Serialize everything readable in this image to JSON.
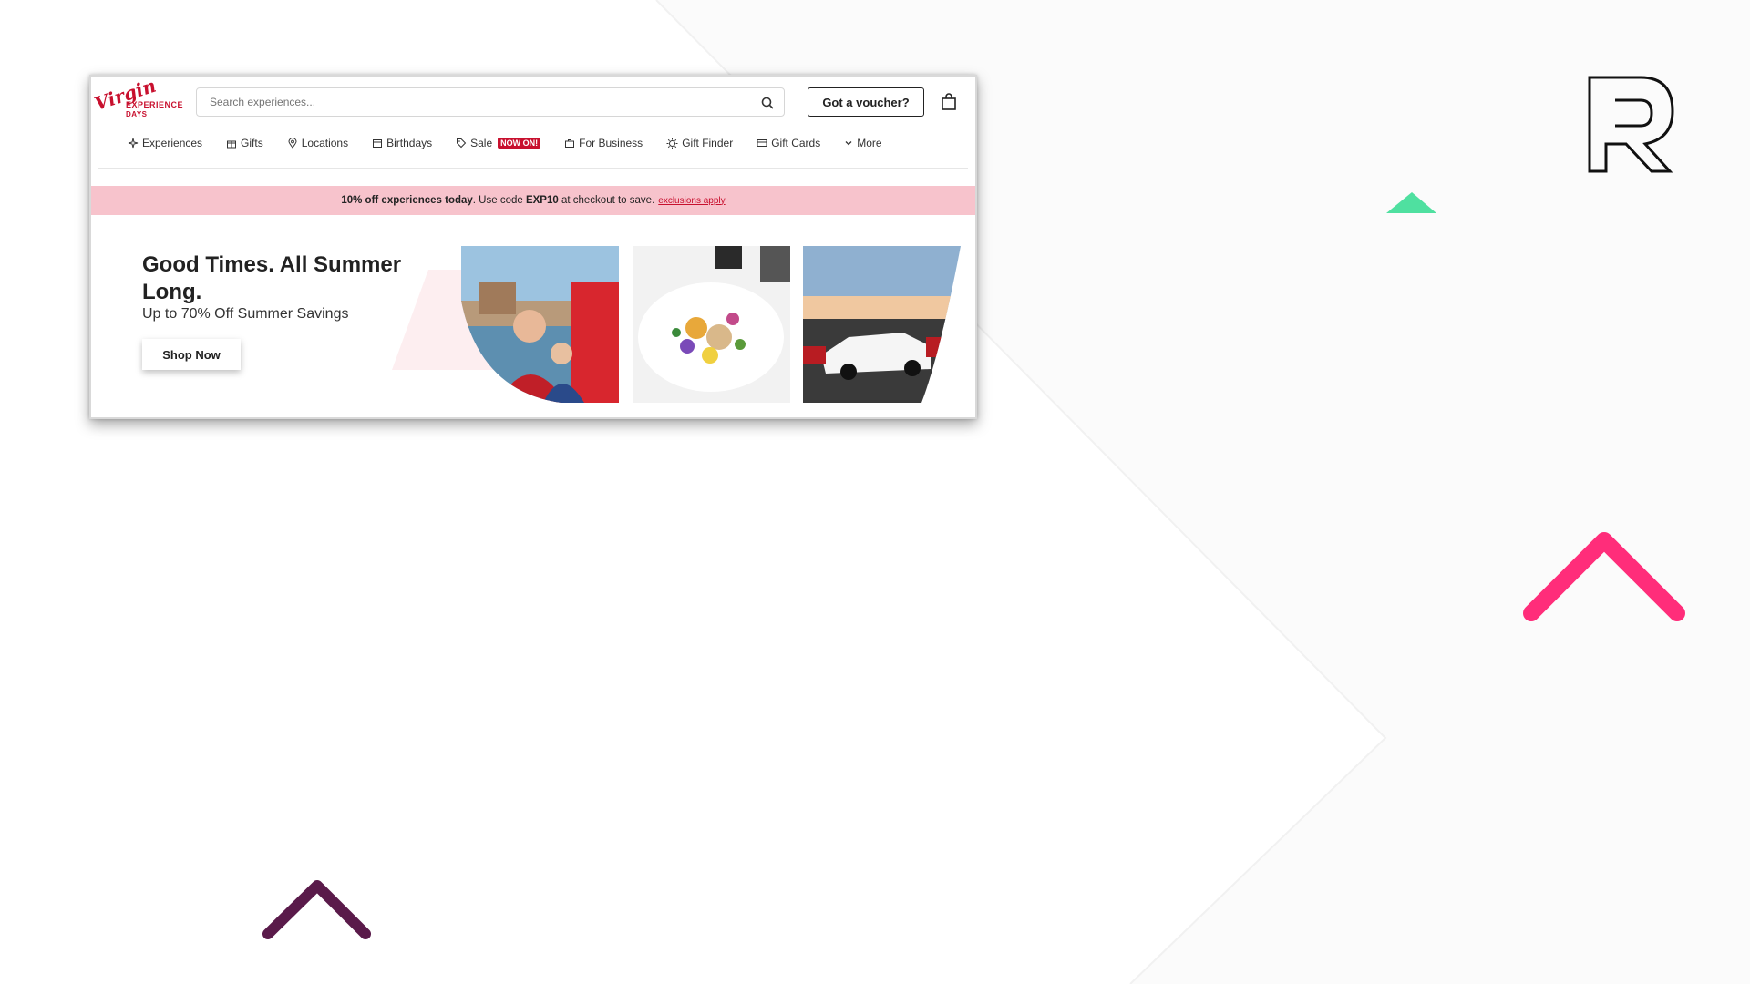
{
  "colors": {
    "brand_red": "#c8102e",
    "promo_bg": "#f7c3cc",
    "accent_pink": "#ff2d7a",
    "accent_green": "#4fe0a0",
    "accent_plum": "#5a1a4a"
  },
  "logo": {
    "script": "Virgin",
    "line1": "EXPERIENCE",
    "line2": "DAYS"
  },
  "search": {
    "placeholder": "Search experiences..."
  },
  "header": {
    "voucher_label": "Got a voucher?"
  },
  "nav": {
    "items": [
      {
        "label": "Experiences",
        "icon": "sparkle-icon"
      },
      {
        "label": "Gifts",
        "icon": "gift-icon"
      },
      {
        "label": "Locations",
        "icon": "location-pin-icon"
      },
      {
        "label": "Birthdays",
        "icon": "calendar-icon"
      },
      {
        "label": "Sale",
        "icon": "tag-icon",
        "badge": "NOW ON!"
      },
      {
        "label": "For Business",
        "icon": "briefcase-icon"
      },
      {
        "label": "Gift Finder",
        "icon": "sun-icon"
      },
      {
        "label": "Gift Cards",
        "icon": "card-icon"
      },
      {
        "label": "More",
        "icon": "chevron-down-icon"
      }
    ]
  },
  "promo": {
    "bold": "10% off experiences today",
    "text1": ". Use code ",
    "code": "EXP10",
    "text2": " at checkout to save.",
    "link": "exclusions apply"
  },
  "hero": {
    "title": "Good Times. All Summer Long.",
    "subtitle": "Up to 70% Off Summer Savings",
    "cta": "Shop Now"
  }
}
